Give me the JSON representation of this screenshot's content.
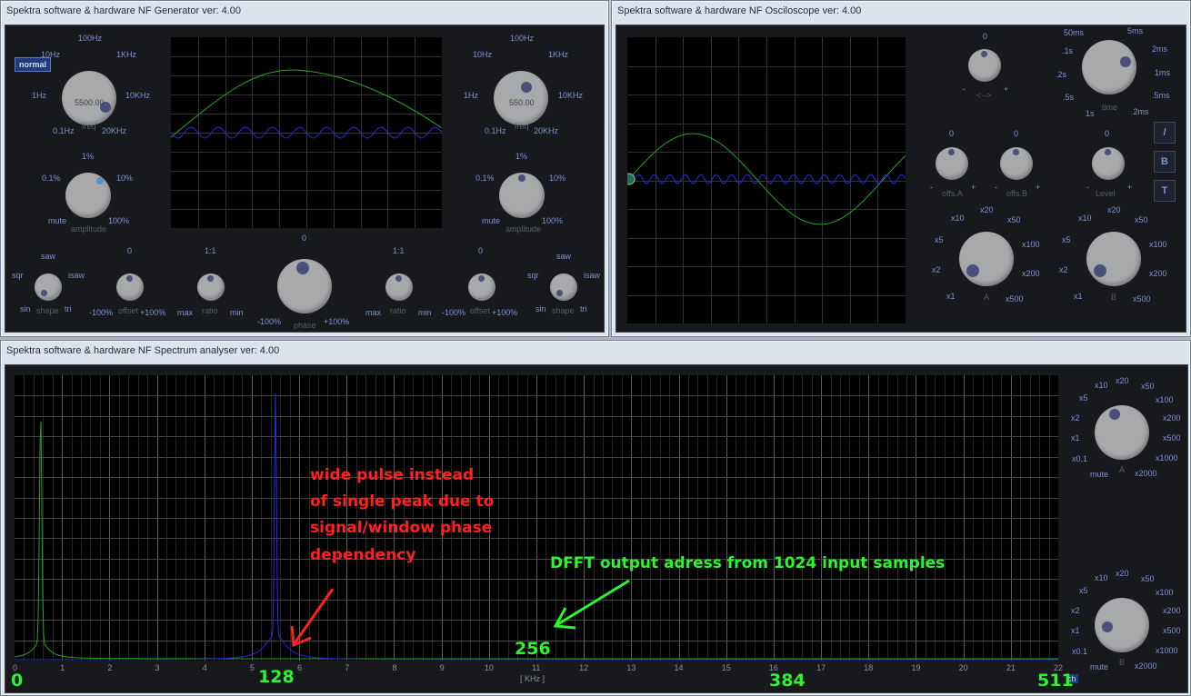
{
  "generator": {
    "title": "Spektra software & hardware NF Generator ver: 4.00",
    "mode_label": "normal",
    "freq_left": {
      "value": "5500.00",
      "caption": "freq",
      "labels": [
        "100Hz",
        "1KHz",
        "10KHz",
        "20KHz",
        "0.1Hz",
        "1Hz",
        "10Hz"
      ]
    },
    "freq_right": {
      "value": "550.00",
      "caption": "freq",
      "labels": [
        "100Hz",
        "1KHz",
        "10KHz",
        "20KHz",
        "0.1Hz",
        "1Hz",
        "10Hz"
      ]
    },
    "amp_left": {
      "caption": "amplitude",
      "labels": [
        "1%",
        "10%",
        "100%",
        "mute",
        "0.1%"
      ]
    },
    "amp_right": {
      "caption": "amplitude",
      "labels": [
        "1%",
        "10%",
        "100%",
        "mute",
        "0.1%"
      ]
    },
    "shape_left": {
      "caption": "shape",
      "labels": [
        "saw",
        "isaw",
        "tri",
        "sin",
        "sqr"
      ]
    },
    "shape_right": {
      "caption": "shape",
      "labels": [
        "saw",
        "isaw",
        "tri",
        "sin",
        "sqr"
      ]
    },
    "offset_left": {
      "caption": "offset",
      "labels": [
        "0",
        "-100%",
        "+100%"
      ]
    },
    "offset_right": {
      "caption": "offset",
      "labels": [
        "0",
        "-100%",
        "+100%"
      ]
    },
    "ratio_left": {
      "caption": "ratio",
      "labels": [
        "1:1",
        "max",
        "min"
      ]
    },
    "ratio_right": {
      "caption": "ratio",
      "labels": [
        "1:1",
        "max",
        "min"
      ]
    },
    "phase": {
      "caption": "phase",
      "labels": [
        "0",
        "-100%",
        "+100%"
      ]
    }
  },
  "oscilloscope": {
    "title": "Spektra software & hardware NF Osciloscope ver: 4.00",
    "pos": {
      "caption": "<-->",
      "labels": [
        "0",
        "-",
        "+"
      ]
    },
    "offs_a": {
      "caption": "offs.A",
      "labels": [
        "0",
        "-",
        "+"
      ]
    },
    "offs_b": {
      "caption": "offs.B",
      "labels": [
        "0",
        "-",
        "+"
      ]
    },
    "level": {
      "caption": "Level",
      "labels": [
        "0",
        "-",
        "+"
      ]
    },
    "time": {
      "caption": "time",
      "labels": [
        "50ms",
        "5ms",
        "2ms",
        "1ms",
        ".5ms",
        ".2ms",
        "1s",
        ".5s",
        ".2s",
        ".1s"
      ]
    },
    "gain_a": {
      "caption": "A",
      "labels": [
        "x20",
        "x50",
        "x100",
        "x200",
        "x500",
        "x1",
        "x2",
        "x5",
        "x10"
      ]
    },
    "gain_b": {
      "caption": "B",
      "labels": [
        "x20",
        "x50",
        "x100",
        "x200",
        "x500",
        "x1",
        "x2",
        "x5",
        "x10"
      ]
    },
    "buttons": [
      "/",
      "B",
      "T"
    ]
  },
  "analyser": {
    "title": "Spektra software & hardware NF Spectrum analyser ver: 4.00",
    "axis_unit": "[ KHz ]",
    "x_ticks": [
      "0",
      "1",
      "2",
      "3",
      "4",
      "5",
      "6",
      "7",
      "8",
      "9",
      "10",
      "11",
      "12",
      "13",
      "14",
      "15",
      "16",
      "17",
      "18",
      "19",
      "20",
      "21",
      "22"
    ],
    "gain_a": {
      "caption": "A",
      "labels": [
        "x20",
        "x50",
        "x100",
        "x200",
        "x500",
        "x1000",
        "x2000",
        "mute",
        "x0.1",
        "x1",
        "x2",
        "x5",
        "x10"
      ]
    },
    "gain_b": {
      "caption": "B",
      "labels": [
        "x20",
        "x50",
        "x100",
        "x200",
        "x500",
        "x1000",
        "x2000",
        "mute",
        "x0.1",
        "x1",
        "x2",
        "x5",
        "x10"
      ]
    },
    "corner_mark": "ch"
  },
  "annotations": {
    "red_text": [
      "wide pulse instead",
      "of single peak due to",
      "signal/window phase",
      "dependency"
    ],
    "green_text": "DFFT output adress from 1024 input samples",
    "addr_0": "0",
    "addr_128": "128",
    "addr_256": "256",
    "addr_384": "384",
    "addr_511": "511"
  },
  "colors": {
    "trace_a": "#1fa81f",
    "trace_b": "#2a2ae0",
    "screen": "#000000",
    "grid": "#3a3a3a",
    "knob": "#a7a9ab",
    "label": "#7f93d6"
  }
}
